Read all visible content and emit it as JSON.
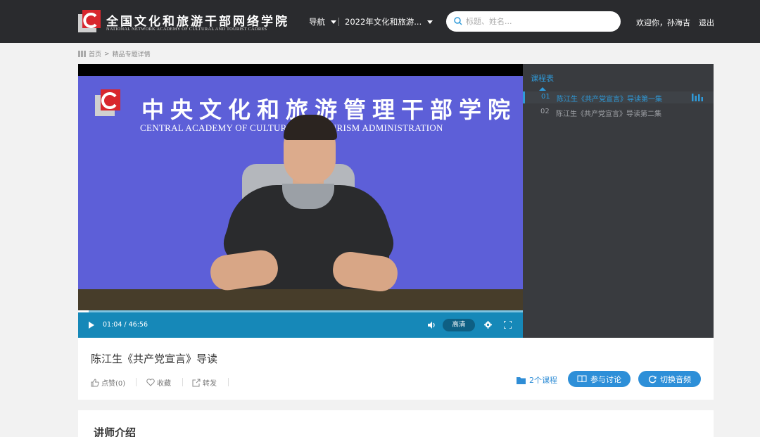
{
  "header": {
    "logo_cn": "全国文化和旅游干部网络学院",
    "logo_en": "NATIONAL NETWORK ACADEMY OF CULTURAL AND TOURIST CADRES",
    "nav_label": "导航",
    "nav_program": "2022年文化和旅游...",
    "search_placeholder": "标题、姓名...",
    "welcome": "欢迎你，孙海吉",
    "logout": "退出"
  },
  "breadcrumb": {
    "home": "首页",
    "sep": ">",
    "current": "精品专题详情"
  },
  "player": {
    "backdrop_title": "中央文化和旅游管理干部学院",
    "backdrop_en": "CENTRAL ACADEMY OF CULTURE AND TOURISM ADMINISTRATION",
    "time_display": "01:04 / 46:56",
    "progress": 0.023,
    "quality_label": "高清"
  },
  "playlist": {
    "title": "课程表",
    "items": [
      {
        "num": "01",
        "title": "陈江生《共产党宣言》导读第一集",
        "active": true
      },
      {
        "num": "02",
        "title": "陈江生《共产党宣言》导读第二集",
        "active": false
      }
    ]
  },
  "lesson": {
    "title": "陈江生《共产党宣言》导读",
    "like_label": "点赞(0)",
    "favorite_label": "收藏",
    "share_label": "转发",
    "course_count": "2个课程",
    "discuss_label": "参与讨论",
    "audio_label": "切换音频"
  },
  "lecturer": {
    "section_title": "讲师介绍"
  },
  "colors": {
    "accent": "#2d8fd8",
    "header_bg": "#2a2b2e",
    "player_bar": "#1688b8",
    "playlist_bg": "#393b3f",
    "backdrop": "#5d5fd8"
  }
}
